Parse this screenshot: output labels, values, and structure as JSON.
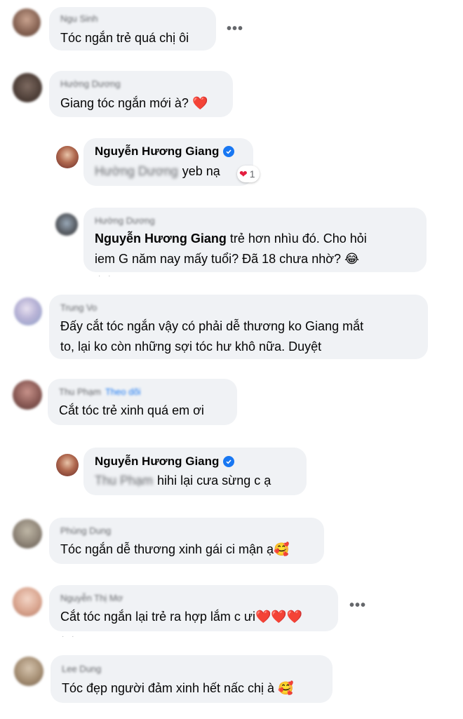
{
  "comments": [
    {
      "name": "Ngu Sinh",
      "text": "Tóc ngắn trẻ quá chị ôi",
      "more": "•••"
    },
    {
      "name": "Hường Dương",
      "text": "Giang tóc ngắn mới à?",
      "emoji": "❤️"
    },
    {
      "name": "Nguyễn Hương Giang",
      "mention": "Hường Dương",
      "text": "yeb nạ",
      "reaction_emoji": "❤",
      "reaction_count": "1"
    },
    {
      "name": "Hường Dương",
      "mention": "Nguyễn Hương Giang",
      "line1": "trẻ hơn nhìu đó. Cho hỏi",
      "line2": "iem G năm nay mấy tuổi? Đã 18 chưa nhờ?",
      "emoji": "😂"
    },
    {
      "name": "Trung Vo",
      "line1": "Đấy cắt tóc ngắn vậy có phải dễ thương ko Giang mắt",
      "line2": "to, lại ko còn những sợi tóc hư khô nữa. Duyệt"
    },
    {
      "name": "Thu Phạm",
      "follow": "Theo dõi",
      "text": "Cắt tóc trẻ xinh quá em ơi"
    },
    {
      "name": "Nguyễn Hương Giang",
      "mention": "Thu Phạm",
      "text": "hihi lại cưa sừng c ạ"
    },
    {
      "name": "Phùng Dung",
      "text": "Tóc ngắn dễ thương xinh gái ci mận ạ",
      "emoji": "🥰"
    },
    {
      "name": "Nguyễn Thị Mơ",
      "text": "Cắt tóc ngắn lại trẻ ra hợp lắm c ưi",
      "emoji": "❤️❤️❤️",
      "more": "•••"
    },
    {
      "name": "Lee Dung",
      "text": "Tóc đẹp người đảm xinh hết nấc chị à",
      "emoji": "🥰"
    }
  ],
  "colors": {
    "bubble": "#f0f2f5",
    "accent": "#1877f2",
    "heart": "#e41e3f"
  }
}
